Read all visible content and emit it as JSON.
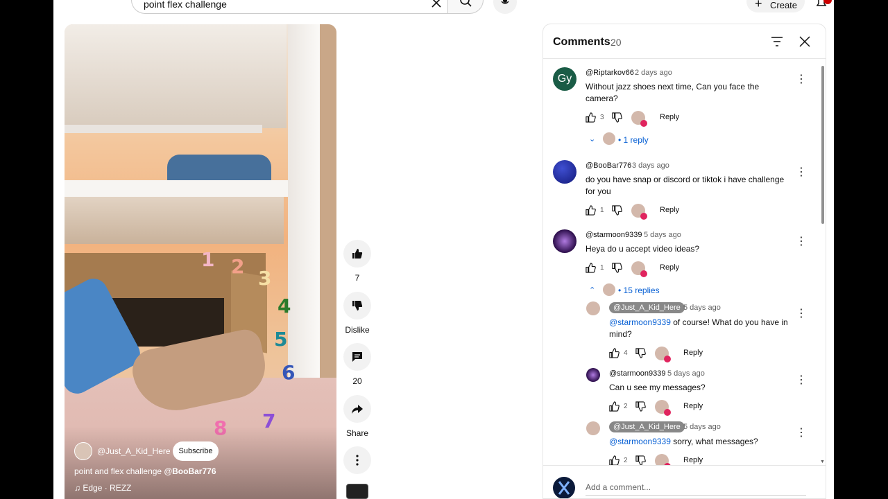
{
  "header": {
    "search_value": "point flex challenge",
    "create_label": "Create"
  },
  "video": {
    "channel": "@Just_A_Kid_Here",
    "subscribe_label": "Subscribe",
    "title_text": "point and flex challenge ",
    "title_mention": "@BooBar776",
    "music": "Edge · REZZ",
    "numbers": [
      "1",
      "2",
      "3",
      "4",
      "5",
      "6",
      "7",
      "8"
    ]
  },
  "actions": {
    "like_count": "7",
    "dislike_label": "Dislike",
    "comment_count": "20",
    "share_label": "Share"
  },
  "comments_panel": {
    "title": "Comments",
    "count": "20",
    "comments": [
      {
        "author": "@Riptarkov66",
        "time": "2 days ago",
        "avatar_text": "Gy",
        "text": "Without jazz shoes next time, Can you face the camera?",
        "likes": "3",
        "reply_label": "Reply",
        "replies_link": "1 reply"
      },
      {
        "author": "@BooBar776",
        "time": "3 days ago",
        "text": "do you have snap or discord or tiktok i have challenge for you",
        "likes": "1",
        "reply_label": "Reply"
      },
      {
        "author": "@starmoon9339",
        "time": "5 days ago",
        "text": "Heya do u accept video ideas?",
        "likes": "1",
        "reply_label": "Reply",
        "replies_link": "15 replies"
      }
    ],
    "replies": [
      {
        "author": "@Just_A_Kid_Here",
        "time": "5 days ago",
        "mention": "@starmoon9339",
        "text": " of course! What do you have in mind?",
        "likes": "4",
        "reply_label": "Reply"
      },
      {
        "author": "@starmoon9339",
        "time": "5 days ago",
        "text": "Can u see my messages?",
        "likes": "2",
        "reply_label": "Reply"
      },
      {
        "author": "@Just_A_Kid_Here",
        "time": "5 days ago",
        "mention": "@starmoon9339",
        "text": " sorry, what messages?",
        "likes": "2",
        "reply_label": "Reply"
      }
    ],
    "add_comment_placeholder": "Add a comment..."
  },
  "colors": {
    "link": "#065fd4",
    "heart": "#e0245e",
    "avatar_gy": "#1a5c46"
  }
}
